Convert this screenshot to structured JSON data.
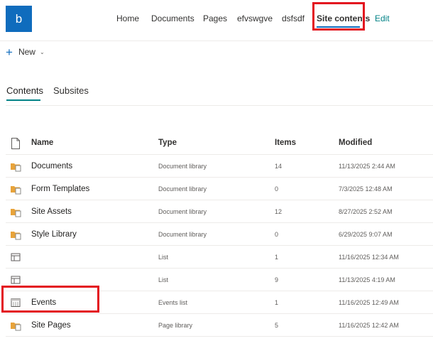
{
  "site": {
    "logo_letter": "b"
  },
  "nav": {
    "items": [
      "Home",
      "Documents",
      "Pages",
      "efvswgve",
      "dsfsdf",
      "Site contents"
    ],
    "edit": "Edit"
  },
  "toolbar": {
    "new_label": "New"
  },
  "tabs": [
    "Contents",
    "Subsites"
  ],
  "table": {
    "headers": {
      "name": "Name",
      "type": "Type",
      "items": "Items",
      "modified": "Modified"
    },
    "rows": [
      {
        "icon": "document-library-icon",
        "name": "Documents",
        "type": "Document library",
        "items": "14",
        "modified": "11/13/2025 2:44 AM"
      },
      {
        "icon": "document-library-icon",
        "name": "Form Templates",
        "type": "Document library",
        "items": "0",
        "modified": "7/3/2025 12:48 AM"
      },
      {
        "icon": "document-library-icon",
        "name": "Site Assets",
        "type": "Document library",
        "items": "12",
        "modified": "8/27/2025 2:52 AM"
      },
      {
        "icon": "document-library-icon",
        "name": "Style Library",
        "type": "Document library",
        "items": "0",
        "modified": "6/29/2025 9:07 AM"
      },
      {
        "icon": "list-icon",
        "name": "",
        "type": "List",
        "items": "1",
        "modified": "11/16/2025 12:34 AM"
      },
      {
        "icon": "list-icon",
        "name": "",
        "type": "List",
        "items": "9",
        "modified": "11/13/2025 4:19 AM"
      },
      {
        "icon": "events-list-icon",
        "name": "Events",
        "type": "Events list",
        "items": "1",
        "modified": "11/16/2025 12:49 AM"
      },
      {
        "icon": "page-library-icon",
        "name": "Site Pages",
        "type": "Page library",
        "items": "5",
        "modified": "11/16/2025 12:42 AM"
      }
    ]
  },
  "colors": {
    "brand": "#0f6cbd",
    "accent_teal": "#038387",
    "highlight_red": "#e3141f"
  }
}
